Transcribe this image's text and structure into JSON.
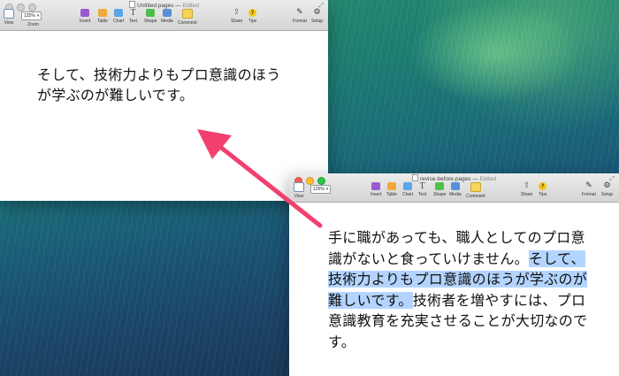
{
  "front_window": {
    "title": "revise-before.pages",
    "edited": "Edited",
    "toolbar": {
      "zoom": "125%",
      "view": "View",
      "insert": "Insert",
      "table": "Table",
      "chart": "Chart",
      "text": "Text",
      "shape": "Shape",
      "media": "Media",
      "comment": "Comment",
      "share": "Share",
      "tips": "Tips",
      "format": "Format",
      "setup": "Setup"
    },
    "document": {
      "before": "手に職があっても、職人としてのプロ意識がないと食っていけません。",
      "selected": "そして、技術力よりもプロ意識のほうが学ぶのが難しいです。",
      "after": "技術者を増やすには、プロ意識教育を充実させることが大切なのです。"
    }
  },
  "back_window": {
    "title": "Untitled.pages",
    "edited": "Edited",
    "toolbar": {
      "zoom": "125%",
      "view": "View",
      "zoom_label": "Zoom",
      "insert": "Insert",
      "table": "Table",
      "chart": "Chart",
      "text": "Text",
      "shape": "Shape",
      "media": "Media",
      "comment": "Comment",
      "share": "Share",
      "tips": "Tips",
      "format": "Format",
      "setup": "Setup"
    },
    "document": {
      "text": "そして、技術力よりもプロ意識のほうが学ぶのが難しいです。"
    }
  },
  "colors": {
    "arrow": "#f2406e",
    "selection": "#b3d4ff"
  }
}
